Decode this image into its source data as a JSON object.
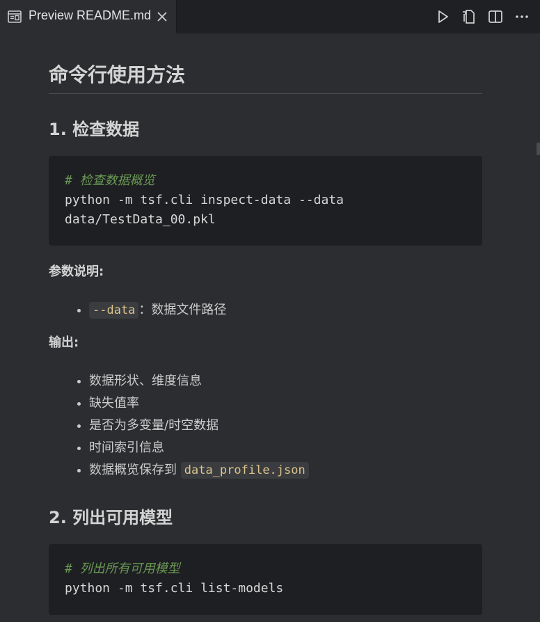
{
  "tab": {
    "title": "Preview README.md",
    "icon": "preview-icon",
    "close_icon": "close-icon"
  },
  "toolbar": {
    "actions": [
      "run-icon",
      "open-source-icon",
      "split-editor-icon",
      "more-actions-icon"
    ]
  },
  "doc": {
    "title": "命令行使用方法",
    "section1": {
      "heading": "1. 检查数据",
      "code_comment": "# 检查数据概览",
      "code_lines": [
        "python -m tsf.cli inspect-data --data",
        "data/TestData_00.pkl"
      ],
      "params_label": "参数说明:",
      "params": [
        {
          "code": "--data",
          "text": "：数据文件路径"
        }
      ],
      "output_label": "输出:",
      "outputs": [
        "数据形状、维度信息",
        "缺失值率",
        "是否为多变量/时空数据",
        "时间索引信息"
      ],
      "output_last_text": "数据概览保存到 ",
      "output_last_code": "data_profile.json"
    },
    "section2": {
      "heading": "2. 列出可用模型",
      "code_comment": "# 列出所有可用模型",
      "code_lines": [
        "python -m tsf.cli list-models"
      ]
    }
  },
  "colors": {
    "background": "#2b2d30",
    "code_bg": "#1e1f22",
    "comment": "#6a9955",
    "inline_code": "#dcc48a"
  }
}
